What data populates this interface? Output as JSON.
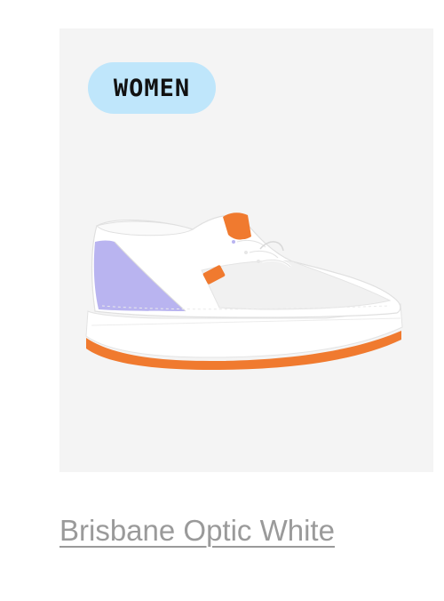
{
  "product": {
    "badge": "WOMEN",
    "title": "Brisbane Optic White",
    "image_icon": "sneaker-image",
    "colors": {
      "badge_bg": "#bfe6fb",
      "image_bg": "#f4f4f4",
      "title": "#9a9a9a",
      "accent_orange": "#f07a2f",
      "accent_lavender": "#b9b4f0"
    }
  }
}
